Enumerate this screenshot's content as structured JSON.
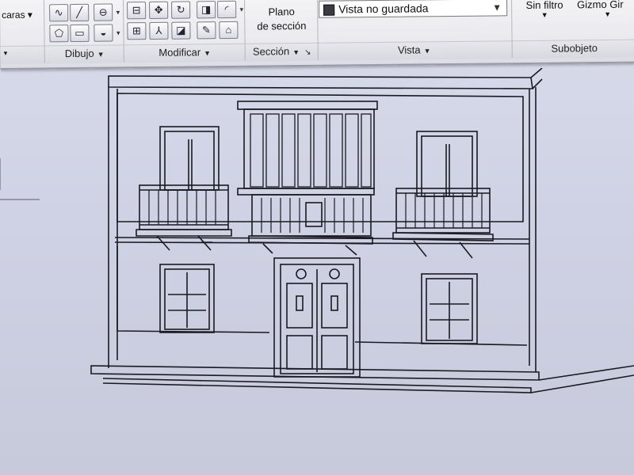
{
  "ribbon": {
    "caras_label": "caras",
    "panels": {
      "dibujo": "Dibujo",
      "modificar": "Modificar",
      "seccion": "Sección",
      "vista": "Vista",
      "subobjeto": "Subobjeto"
    },
    "plano_line1": "Plano",
    "plano_line2": "de sección",
    "view_select_value": "Vista no guardada",
    "filter_label": "Sin filtro",
    "gizmo_label": "Gizmo Gir"
  },
  "icons": {
    "dibujo": [
      "polyline-icon",
      "line-icon",
      "circle-icon",
      "polygon-icon",
      "rectangle-icon",
      "region-icon"
    ],
    "modificar": [
      "move-icon",
      "array-icon",
      "rotate-icon",
      "mirror-icon",
      "fillet-icon",
      "align-icon",
      "scale-icon",
      "offset-icon",
      "erase-icon"
    ]
  }
}
